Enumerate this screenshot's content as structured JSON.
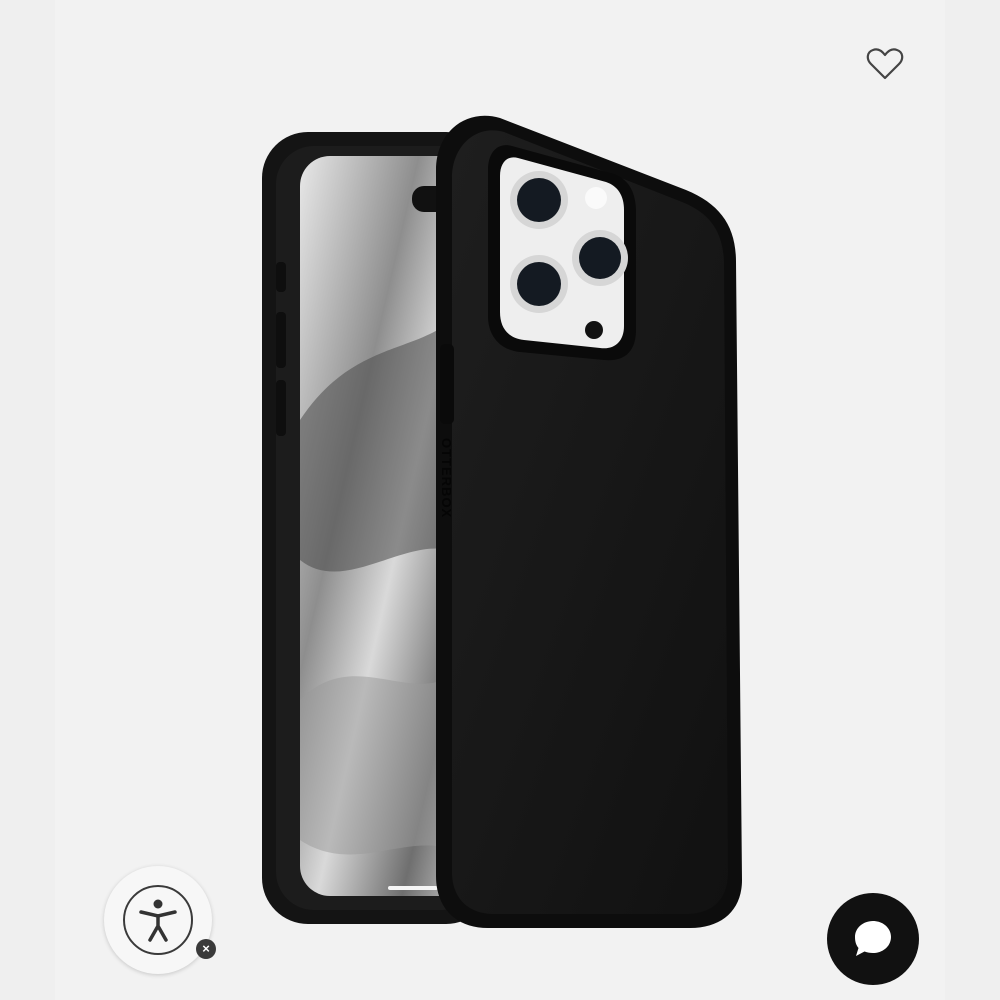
{
  "product": {
    "brand_text": "OTTERBOX"
  },
  "colors": {
    "background": "#efefef",
    "case": "#161616",
    "chat_button": "#111111"
  },
  "icons": {
    "favorite": "heart-outline-icon",
    "accessibility": "accessibility-person-icon",
    "accessibility_dismiss": "close-icon",
    "chat": "chat-bubble-icon"
  }
}
